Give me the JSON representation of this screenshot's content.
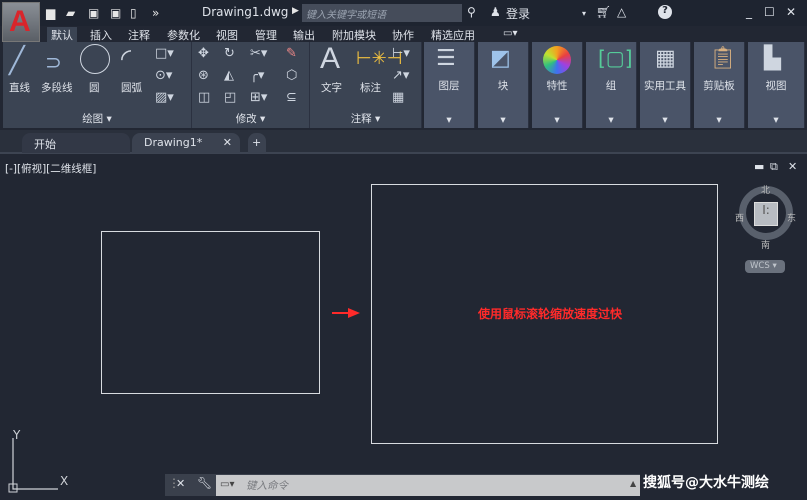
{
  "app": {
    "doc_title": "Drawing1.dwg",
    "search_placeholder": "键入关键字或短语",
    "login": "登录",
    "logo_letter": "A"
  },
  "ribbon_tabs": [
    "默认",
    "插入",
    "注释",
    "参数化",
    "视图",
    "管理",
    "输出",
    "附加模块",
    "协作",
    "精选应用"
  ],
  "draw": {
    "title": "绘图",
    "tools": [
      "直线",
      "多段线",
      "圆",
      "圆弧"
    ]
  },
  "modify": {
    "title": "修改"
  },
  "annotation": {
    "title": "注释",
    "tools": [
      "文字",
      "标注"
    ]
  },
  "panels": [
    "图层",
    "块",
    "特性",
    "组",
    "实用工具",
    "剪贴板",
    "视图"
  ],
  "doc_tabs": {
    "start": "开始",
    "drawing": "Drawing1*"
  },
  "viewport": {
    "label": "[-][俯视][二维线框]",
    "message": "使用鼠标滚轮缩放速度过快"
  },
  "viewcube": {
    "north": "北",
    "south": "南",
    "east": "东",
    "west": "西",
    "wcs": "WCS"
  },
  "ucs": {
    "x": "X",
    "y": "Y"
  },
  "command": {
    "placeholder": "键入命令"
  },
  "watermark": "搜狐号@大水牛测绘",
  "colors": {
    "accent_red": "#ff2a2a",
    "canvas": "#222733"
  }
}
